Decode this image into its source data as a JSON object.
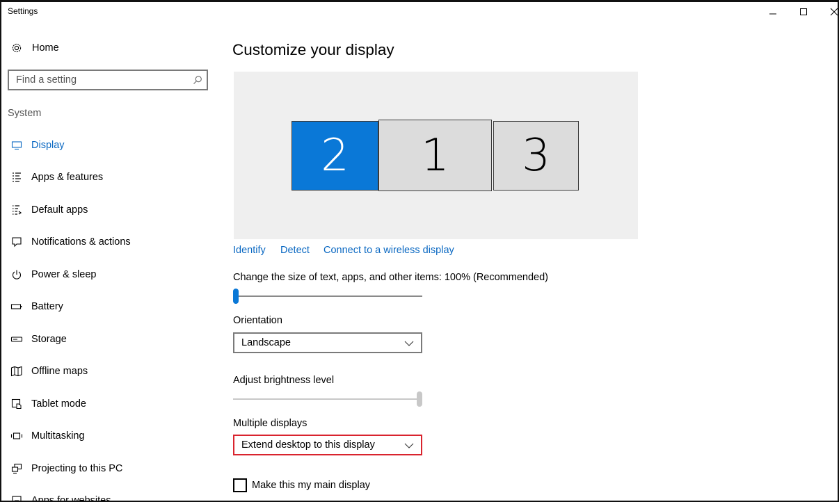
{
  "window": {
    "title": "Settings",
    "controls": {
      "minimize_icon": "minimize-icon",
      "maximize_icon": "maximize-icon",
      "close_icon": "close-icon"
    }
  },
  "sidebar": {
    "home": {
      "label": "Home",
      "icon": "gear-icon"
    },
    "search": {
      "placeholder": "Find a setting",
      "icon": "search-icon"
    },
    "section": "System",
    "items": [
      {
        "label": "Display",
        "icon": "monitor-icon",
        "active": true
      },
      {
        "label": "Apps & features",
        "icon": "list-icon"
      },
      {
        "label": "Default apps",
        "icon": "default-apps-icon"
      },
      {
        "label": "Notifications & actions",
        "icon": "speech-bubble-icon"
      },
      {
        "label": "Power & sleep",
        "icon": "power-icon"
      },
      {
        "label": "Battery",
        "icon": "battery-icon"
      },
      {
        "label": "Storage",
        "icon": "storage-drive-icon"
      },
      {
        "label": "Offline maps",
        "icon": "map-icon"
      },
      {
        "label": "Tablet mode",
        "icon": "tablet-mode-icon"
      },
      {
        "label": "Multitasking",
        "icon": "multitasking-icon"
      },
      {
        "label": "Projecting to this PC",
        "icon": "projecting-icon"
      },
      {
        "label": "Apps for websites",
        "icon": "apps-websites-icon"
      }
    ]
  },
  "main": {
    "title": "Customize your display",
    "monitors": [
      {
        "number": "2",
        "selected": true
      },
      {
        "number": "1",
        "selected": false
      },
      {
        "number": "3",
        "selected": false
      }
    ],
    "links": {
      "identify": "Identify",
      "detect": "Detect",
      "wireless": "Connect to a wireless display"
    },
    "scale": {
      "label": "Change the size of text, apps, and other items: 100% (Recommended)",
      "level": 0
    },
    "orientation": {
      "label": "Orientation",
      "value": "Landscape"
    },
    "brightness": {
      "label": "Adjust brightness level",
      "level": 1.0
    },
    "multiple_displays": {
      "label": "Multiple displays",
      "value": "Extend desktop to this display",
      "highlight_color": "#d9242e"
    },
    "main_display": {
      "label": "Make this my main display",
      "checked": false
    }
  },
  "colors": {
    "accent": "#0a78d7",
    "link": "#0a68c2",
    "preview_bg": "#efefef",
    "monitor_inactive": "#dcdcdc"
  }
}
